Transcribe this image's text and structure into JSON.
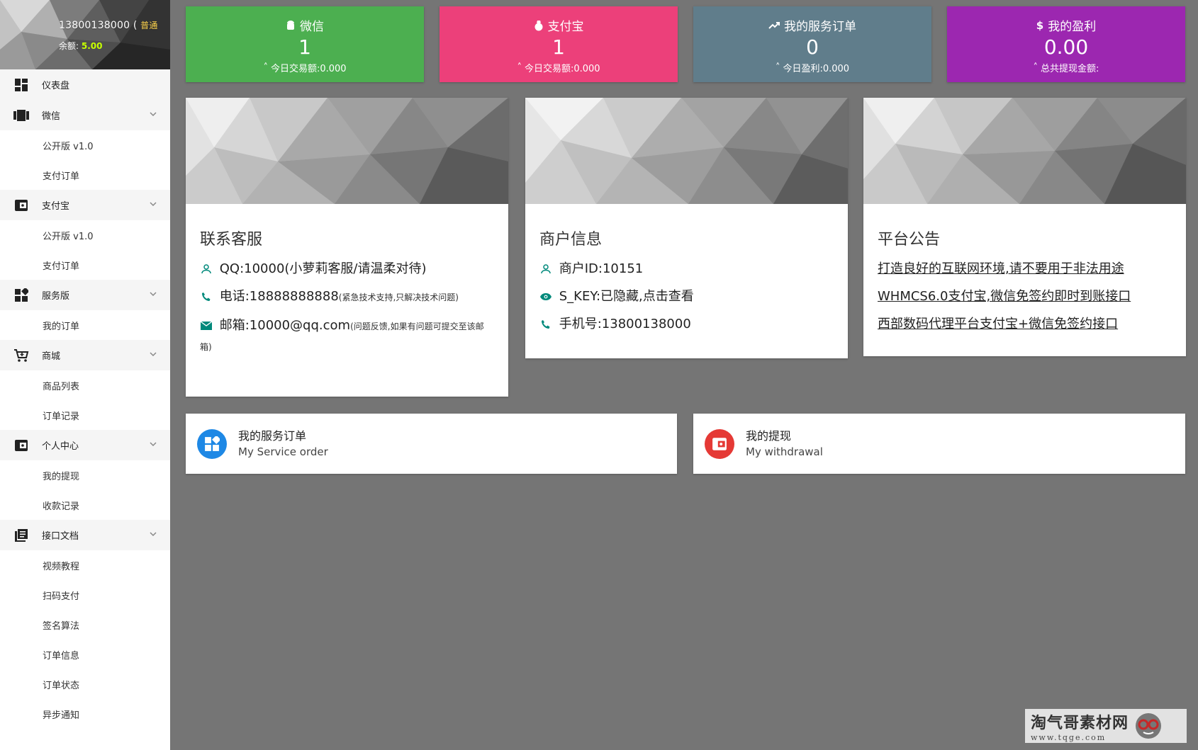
{
  "profile": {
    "phone": "13800138000 (",
    "level": "普通",
    "balance_label": "余额:",
    "balance_value": "5.00"
  },
  "menu": [
    {
      "label": "仪表盘",
      "icon": "dashboard-icon",
      "children": []
    },
    {
      "label": "微信",
      "icon": "wechat-icon",
      "children": [
        "公开版 v1.0",
        "支付订单"
      ]
    },
    {
      "label": "支付宝",
      "icon": "alipay-icon",
      "children": [
        "公开版 v1.0",
        "支付订单"
      ]
    },
    {
      "label": "服务版",
      "icon": "apps-icon",
      "children": [
        "我的订单"
      ]
    },
    {
      "label": "商城",
      "icon": "cart-icon",
      "children": [
        "商品列表",
        "订单记录"
      ]
    },
    {
      "label": "个人中心",
      "icon": "wallet-icon",
      "children": [
        "我的提现",
        "收款记录"
      ]
    },
    {
      "label": "接口文档",
      "icon": "docs-icon",
      "children": [
        "视频教程",
        "扫码支付",
        "签名算法",
        "订单信息",
        "订单状态",
        "异步通知"
      ]
    }
  ],
  "stats": [
    {
      "title": "微信",
      "value": "1",
      "sub": "今日交易额:0.000",
      "color": "#4caf50",
      "icon": "android-icon"
    },
    {
      "title": "支付宝",
      "value": "1",
      "sub": "今日交易额:0.000",
      "color": "#ec407a",
      "icon": "alipay-bag-icon"
    },
    {
      "title": "我的服务订单",
      "value": "0",
      "sub": "今日盈利:0.000",
      "color": "#607d8b",
      "icon": "trending-up-icon"
    },
    {
      "title": "我的盈利",
      "value": "0.00",
      "sub": "总共提现金额:",
      "color": "#9c27b0",
      "icon": "dollar-icon"
    }
  ],
  "contact": {
    "title": "联系客服",
    "qq": "QQ:10000(小萝莉客服/请温柔对待)",
    "phone_label": "电话:18888888888",
    "phone_note": "(紧急技术支持,只解决技术问题)",
    "email_label": "邮箱:10000@qq.com",
    "email_note": "(问题反馈,如果有问题可提交至该邮箱)"
  },
  "merchant": {
    "title": "商户信息",
    "id": "商户ID:10151",
    "skey": "S_KEY:已隐藏,点击查看",
    "mobile": "手机号:13800138000"
  },
  "notice": {
    "title": "平台公告",
    "links": [
      "打造良好的互联网环境,请不要用于非法用途",
      "WHMCS6.0支付宝,微信免签约即时到账接口",
      "西部数码代理平台支付宝+微信免签约接口"
    ]
  },
  "tiles": [
    {
      "title": "我的服务订单",
      "subtitle": "My Service order",
      "color": "#1e88e5",
      "icon": "apps-icon"
    },
    {
      "title": "我的提现",
      "subtitle": "My withdrawal",
      "color": "#e53935",
      "icon": "wallet-icon"
    }
  ],
  "watermark": {
    "main": "淘气哥素材网",
    "url": "www.tqge.com"
  }
}
